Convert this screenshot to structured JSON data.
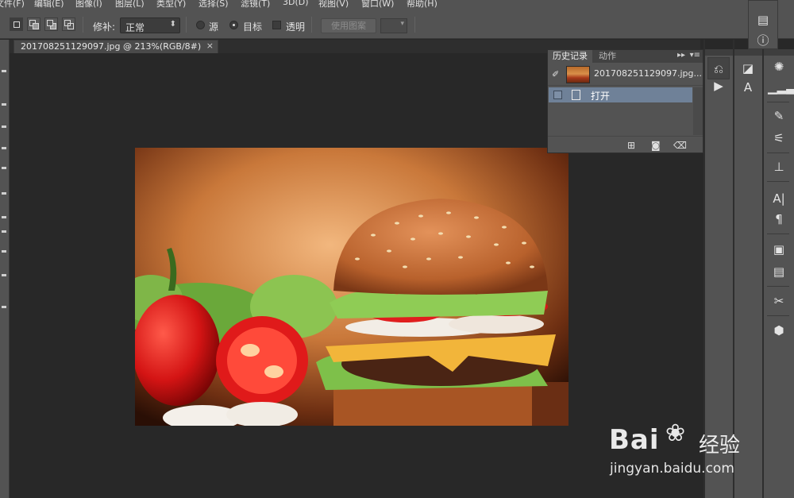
{
  "menu": {
    "items": [
      "文件(F)",
      "编辑(E)",
      "图像(I)",
      "图层(L)",
      "类型(Y)",
      "选择(S)",
      "滤镜(T)",
      "3D(D)",
      "视图(V)",
      "窗口(W)",
      "帮助(H)"
    ]
  },
  "options_bar": {
    "patch_label": "修补:",
    "patch_value": "正常",
    "source_label": "源",
    "target_label": "目标",
    "transparent_label": "透明",
    "use_pattern_label": "使用图案",
    "selected_option": "目标"
  },
  "document": {
    "tab_title": "201708251129097.jpg @ 213%(RGB/8#)",
    "close_glyph": "×"
  },
  "history_panel": {
    "tabs": [
      "历史记录",
      "动作"
    ],
    "active_tab": "历史记录",
    "collapse_glyph": "▸▸",
    "menu_glyph": "▾≡",
    "snapshot_name": "201708251129097.jpg...",
    "states": [
      {
        "label": "打开"
      }
    ],
    "footer_icons": [
      "new-document-from-state-icon",
      "camera-icon",
      "trash-icon"
    ]
  },
  "right_docks": {
    "dock_a": [
      "history-icon",
      "play-icon"
    ],
    "dock_b": [
      "color-swatch-icon",
      "character-style-icon"
    ],
    "dock_c": [
      "compass-icon",
      "levels-icon",
      "brush-icon",
      "adjustments-icon",
      "align-icon",
      "character-icon",
      "paragraph-icon",
      "properties-icon",
      "notes-icon",
      "tools-icon",
      "3d-icon"
    ],
    "top_float": [
      "info-panel-icon",
      "info-icon"
    ]
  },
  "watermark": {
    "brand": "Bai",
    "brand_suffix": "经验",
    "url": "jingyan.baidu.com"
  },
  "colors": {
    "ui_panel": "#535353",
    "canvas_bg": "#282828",
    "selected_state": "#6f8198"
  }
}
